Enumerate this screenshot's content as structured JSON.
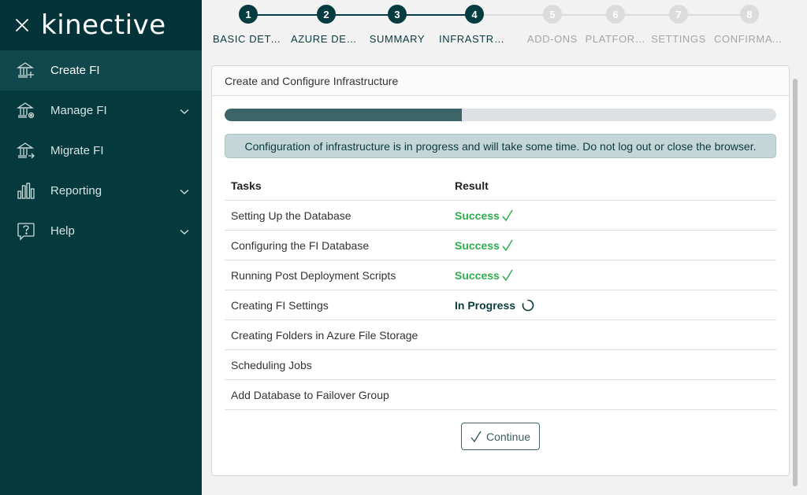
{
  "sidebar": {
    "logo": "kinective",
    "items": [
      {
        "label": "Create FI",
        "icon": "bank-plus-icon",
        "active": true,
        "expandable": false
      },
      {
        "label": "Manage FI",
        "icon": "bank-gear-icon",
        "active": false,
        "expandable": true
      },
      {
        "label": "Migrate FI",
        "icon": "bank-arrow-icon",
        "active": false,
        "expandable": false
      },
      {
        "label": "Reporting",
        "icon": "bar-chart-icon",
        "active": false,
        "expandable": true
      },
      {
        "label": "Help",
        "icon": "help-icon",
        "active": false,
        "expandable": true
      }
    ]
  },
  "stepper": {
    "steps": [
      {
        "number": "1",
        "label": "BASIC DETA…",
        "state": "done"
      },
      {
        "number": "2",
        "label": "AZURE DETA…",
        "state": "done"
      },
      {
        "number": "3",
        "label": "SUMMARY",
        "state": "done"
      },
      {
        "number": "4",
        "label": "INFRASTRUCT…",
        "state": "done"
      },
      {
        "number": "5",
        "label": "ADD-ONS",
        "state": "pending"
      },
      {
        "number": "6",
        "label": "PLATFOR…",
        "state": "pending"
      },
      {
        "number": "7",
        "label": "SETTINGS",
        "state": "pending"
      },
      {
        "number": "8",
        "label": "CONFIRMATI…",
        "state": "pending"
      }
    ]
  },
  "card": {
    "title": "Create and Configure Infrastructure",
    "progress_percent": 43,
    "alert": "Configuration of infrastructure is in progress and will take some time. Do not log out or close the browser.",
    "columns": {
      "task": "Tasks",
      "result": "Result"
    },
    "tasks": [
      {
        "name": "Setting Up the Database",
        "result": "Success",
        "state": "success"
      },
      {
        "name": "Configuring the FI Database",
        "result": "Success",
        "state": "success"
      },
      {
        "name": "Running Post Deployment Scripts",
        "result": "Success",
        "state": "success"
      },
      {
        "name": "Creating FI Settings",
        "result": "In Progress",
        "state": "progress"
      },
      {
        "name": "Creating Folders in Azure File Storage",
        "result": "",
        "state": "none"
      },
      {
        "name": "Scheduling Jobs",
        "result": "",
        "state": "none"
      },
      {
        "name": "Add Database to Failover Group",
        "result": "",
        "state": "none"
      }
    ],
    "continue_label": "Continue"
  },
  "colors": {
    "sidebar_bg": "#04393d",
    "accent": "#053c41",
    "success": "#2eac4f",
    "progress_fill": "#3d6468"
  }
}
